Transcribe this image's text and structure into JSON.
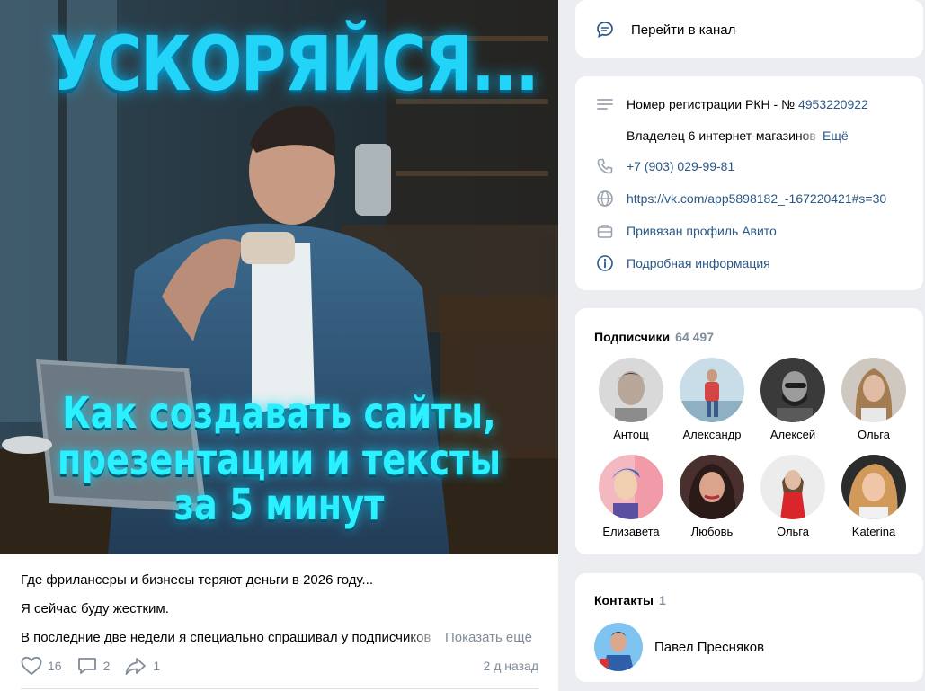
{
  "post": {
    "image": {
      "headline": "УСКОРЯЙСЯ...",
      "subline1": "Как создавать сайты,",
      "subline2": "презентации и тексты",
      "subline3": "за 5 минут"
    },
    "text_line1": "Где фрилансеры и бизнесы теряют деньги в 2026 году...",
    "text_line2": "Я сейчас буду жестким.",
    "text_line3": "В последние две недели я специально спрашивал у подписчиков",
    "show_more": "Показать ещё",
    "likes": "16",
    "comments": "2",
    "shares": "1",
    "time": "2 д назад"
  },
  "channel": {
    "go_label": "Перейти в канал"
  },
  "info": {
    "registration_label": "Номер регистрации РКН - № ",
    "registration_number": "4953220922",
    "description": "Владелец 6 интернет-магазинов",
    "more": "Ещё",
    "phone": "+7 (903) 029-99-81",
    "website": "https://vk.com/app5898182_-167220421#s=30",
    "avito": "Привязан профиль Авито",
    "details": "Подробная информация"
  },
  "subscribers": {
    "title": "Подписчики",
    "count": "64 497",
    "items": [
      {
        "name": "Антощ"
      },
      {
        "name": "Александр"
      },
      {
        "name": "Алексей"
      },
      {
        "name": "Ольга"
      },
      {
        "name": "Елизавета"
      },
      {
        "name": "Любовь"
      },
      {
        "name": "Ольга"
      },
      {
        "name": "Katerina"
      }
    ]
  },
  "contacts": {
    "title": "Контакты",
    "count": "1",
    "name": "Павел Пресняков"
  },
  "colors": {
    "accent_link": "#2a5885",
    "muted": "#818c99",
    "background": "#ebedf0",
    "headline_cyan": "#22d4f7"
  }
}
